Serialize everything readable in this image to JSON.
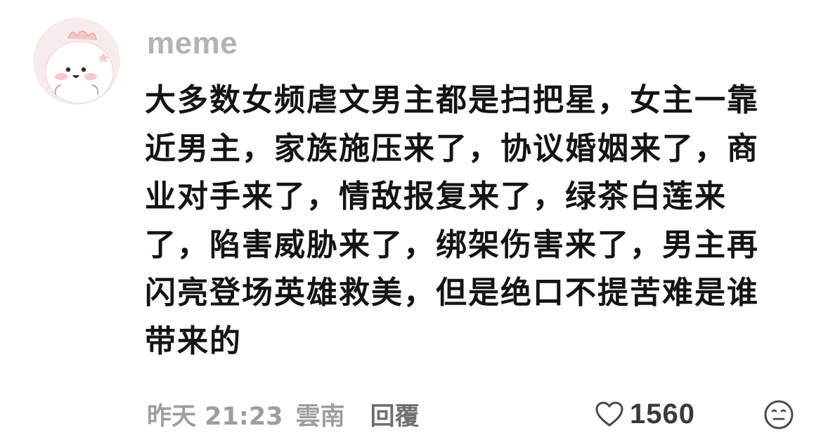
{
  "comment": {
    "username": "meme",
    "avatar_icon": "pink-cartoon-avatar-icon",
    "text": "大多数女频虐文男主都是扫把星，女主一靠近男主，家族施压来了，协议婚姻来了，商业对手来了，情敌报复来了，绿茶白莲来了，陷害威胁来了，绑架伤害来了，男主再闪亮登场英雄救美，但是绝口不提苦难是谁带来的",
    "time": "昨天 21:23",
    "location": "雲南",
    "reply_label": "回覆",
    "like_icon": "heart-outline-icon",
    "like_count": "1560",
    "emoji_icon": "emoji-face-icon"
  },
  "colors": {
    "username": "#b3b3b3",
    "text": "#141414",
    "meta": "#9e9e9e",
    "avatar_bg": "#f7ecec"
  }
}
